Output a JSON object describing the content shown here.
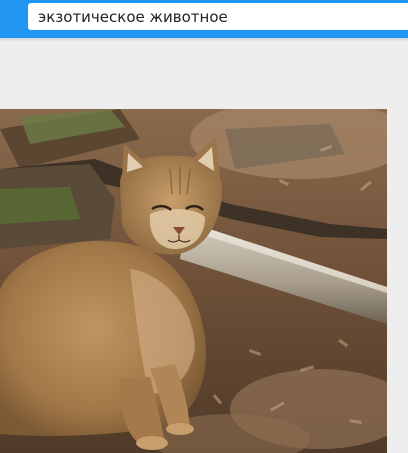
{
  "search": {
    "query": "экзотическое животное"
  },
  "colors": {
    "accent": "#2196f3",
    "background": "#eeeeee"
  },
  "icons": {
    "photo": "jungle-cat-photo"
  }
}
